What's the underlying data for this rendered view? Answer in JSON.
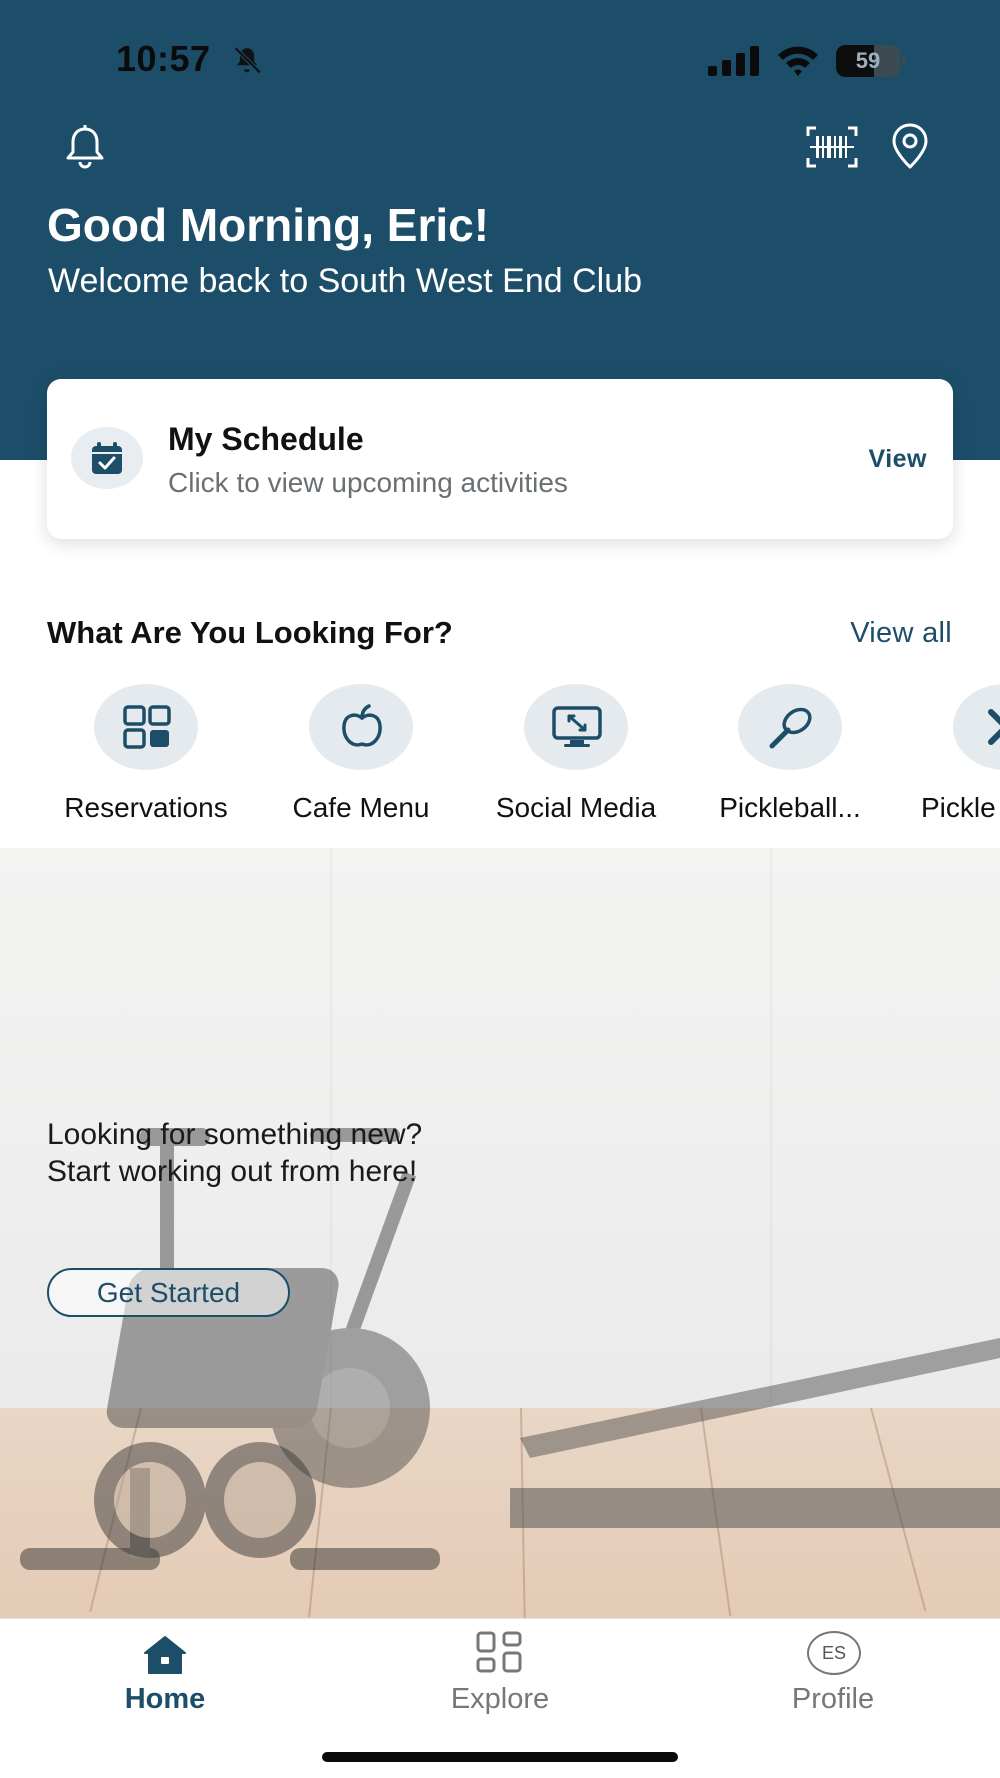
{
  "status_bar": {
    "time": "10:57",
    "battery_level": "59",
    "battery_percent": 59
  },
  "header": {
    "greeting": "Good Morning, Eric!",
    "subtitle": "Welcome back to South West End Club",
    "icons": [
      "bell-icon",
      "barcode-icon",
      "location-pin-icon"
    ],
    "background_color": "#1d4e69"
  },
  "schedule_card": {
    "title": "My Schedule",
    "subtitle": "Click to view upcoming activities",
    "action_label": "View",
    "icon": "calendar-check-icon"
  },
  "shortcuts_section": {
    "title": "What Are You Looking For?",
    "view_all_label": "View all",
    "items": [
      {
        "label": "Reservations",
        "icon": "grid-icon"
      },
      {
        "label": "Cafe Menu",
        "icon": "apple-icon"
      },
      {
        "label": "Social Media",
        "icon": "monitor-icon"
      },
      {
        "label": "Pickleball...",
        "icon": "paddle-icon"
      },
      {
        "label": "Pickle",
        "icon": "crossed-paddles-icon"
      }
    ]
  },
  "promo": {
    "line1": "Looking for something new?",
    "line2": "Start working out from here!",
    "button_label": "Get Started"
  },
  "tab_bar": {
    "tabs": [
      {
        "label": "Home",
        "icon": "home-icon",
        "active": true
      },
      {
        "label": "Explore",
        "icon": "explore-grid-icon",
        "active": false
      },
      {
        "label": "Profile",
        "icon": "avatar-initials",
        "active": false
      }
    ],
    "profile_initials": "ES",
    "accent_color": "#1d4e69"
  }
}
